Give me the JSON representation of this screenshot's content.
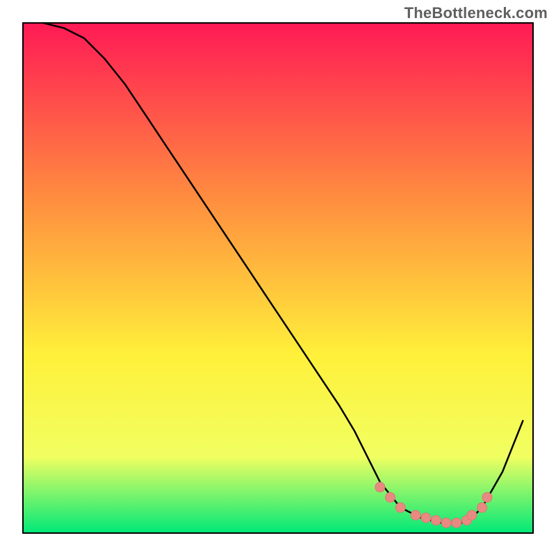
{
  "watermark": "TheBottleneck.com",
  "colors": {
    "gradient_top": "#ff1a55",
    "gradient_upper_mid": "#ff8f3f",
    "gradient_mid": "#fff03a",
    "gradient_lower_mid": "#f1ff61",
    "gradient_bottom": "#00e878",
    "line": "#000000",
    "marker_fill": "#e98a82",
    "marker_stroke": "#d87a72",
    "frame": "#000000"
  },
  "chart_data": {
    "type": "line",
    "title": "",
    "xlabel": "",
    "ylabel": "",
    "xlim": [
      0,
      100
    ],
    "ylim": [
      0,
      100
    ],
    "grid": false,
    "legend": false,
    "series": [
      {
        "name": "bottleneck-curve",
        "x": [
          4,
          8,
          12,
          16,
          20,
          24,
          28,
          32,
          36,
          40,
          44,
          48,
          52,
          56,
          60,
          62,
          65,
          68,
          70,
          74,
          78,
          82,
          86,
          88,
          90,
          94,
          98
        ],
        "y": [
          100,
          99,
          97,
          93,
          88,
          82,
          76,
          70,
          64,
          58,
          52,
          46,
          40,
          34,
          28,
          25,
          20,
          14,
          10,
          5,
          3,
          2,
          2,
          3,
          5,
          12,
          22
        ]
      }
    ],
    "markers": {
      "name": "optimal-range-points",
      "x": [
        70,
        72,
        74,
        77,
        79,
        81,
        83,
        85,
        87,
        88,
        90,
        91
      ],
      "y": [
        9,
        7,
        5,
        3.5,
        3,
        2.5,
        2,
        2,
        2.5,
        3.5,
        5,
        7
      ]
    }
  }
}
